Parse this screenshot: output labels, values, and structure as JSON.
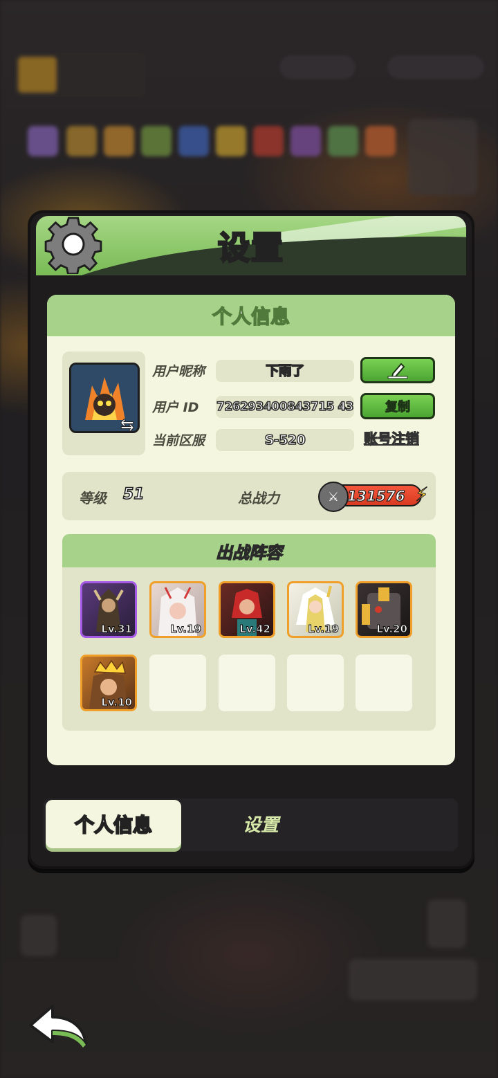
{
  "panel": {
    "title": "设置",
    "icon": "gear-icon"
  },
  "card": {
    "title": "个人信息",
    "fields": {
      "nickname_label": "用户昵称",
      "nickname_value": "下雨了",
      "id_label": "用户 ID",
      "id_value": "726293400843715 43",
      "server_label": "当前区服",
      "server_value": "S-520"
    },
    "buttons": {
      "edit_icon": "pencil-icon",
      "copy_label": "复制",
      "cancel_account_label": "账号注销"
    },
    "stats": {
      "level_label": "等级",
      "level_value": "51",
      "power_label": "总战力",
      "power_value": "131576"
    },
    "lineup": {
      "title": "出战阵容",
      "heroes": [
        {
          "level": "Lv.31"
        },
        {
          "level": "Lv.19"
        },
        {
          "level": "Lv.42"
        },
        {
          "level": "Lv.19"
        },
        {
          "level": "Lv.20"
        },
        {
          "level": "Lv.10"
        }
      ]
    }
  },
  "tabs": {
    "personal_info": "个人信息",
    "settings": "设置"
  },
  "colors": {
    "header_green": "#79bb55",
    "card_bg": "#f4f6df",
    "button_green": "#4aa531",
    "power_red": "#d93a22"
  }
}
